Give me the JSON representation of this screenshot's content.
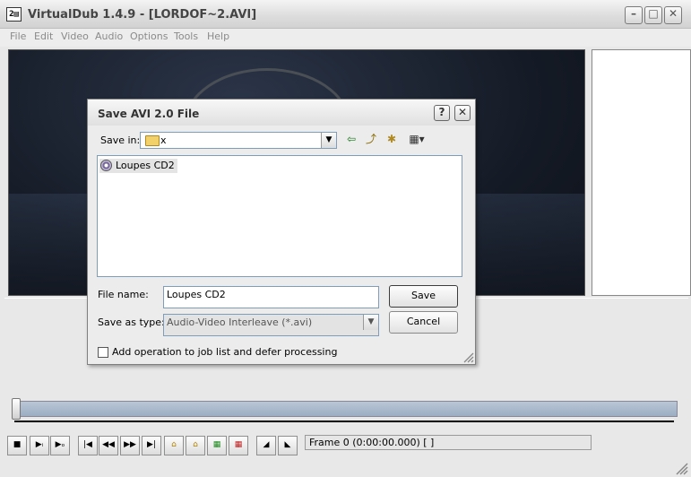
{
  "window": {
    "title": "VirtualDub 1.4.9 - [LORDOF~2.AVI]",
    "icon_glyph": "2▤",
    "minimize_glyph": "–",
    "maximize_glyph": "□",
    "close_glyph": "✕"
  },
  "menu": [
    "File",
    "Edit",
    "Video",
    "Audio",
    "Options",
    "Tools",
    "Help"
  ],
  "toolbar": {
    "buttons": [
      {
        "name": "stop-button",
        "glyph": "■"
      },
      {
        "name": "play-input-button",
        "glyph": "▶ᵢ"
      },
      {
        "name": "play-output-button",
        "glyph": "▶ₒ"
      },
      {
        "name": "go-start-button",
        "glyph": "|◀"
      },
      {
        "name": "step-back-button",
        "glyph": "◀◀"
      },
      {
        "name": "step-forward-button",
        "glyph": "▶▶"
      },
      {
        "name": "go-end-button",
        "glyph": "▶|"
      },
      {
        "name": "prev-keyframe-button",
        "glyph": "⌂"
      },
      {
        "name": "next-keyframe-button",
        "glyph": "⌂"
      },
      {
        "name": "prev-scene-button",
        "glyph": "▦"
      },
      {
        "name": "next-scene-button",
        "glyph": "▦"
      },
      {
        "name": "mark-in-button",
        "glyph": "◢"
      },
      {
        "name": "mark-out-button",
        "glyph": "◣"
      }
    ],
    "frame_status": "Frame 0 (0:00:00.000) [ ]"
  },
  "dialog": {
    "title": "Save AVI 2.0 File",
    "help_glyph": "?",
    "close_glyph": "✕",
    "save_in_label": "Save in:",
    "save_in_value": "x",
    "back_glyph": "⇦",
    "up_glyph": "⤴",
    "new_folder_glyph": "✱",
    "view_glyph": "▦▾",
    "dropdown_glyph": "▼",
    "files": [
      "Loupes CD2"
    ],
    "file_name_label": "File name:",
    "file_name_value": "Loupes CD2",
    "save_as_type_label": "Save as type:",
    "save_as_type_value": "Audio-Video Interleave (*.avi)",
    "save_button": "Save",
    "cancel_button": "Cancel",
    "checkbox_label": "Add operation to job list and defer processing",
    "checkbox_checked": false
  }
}
